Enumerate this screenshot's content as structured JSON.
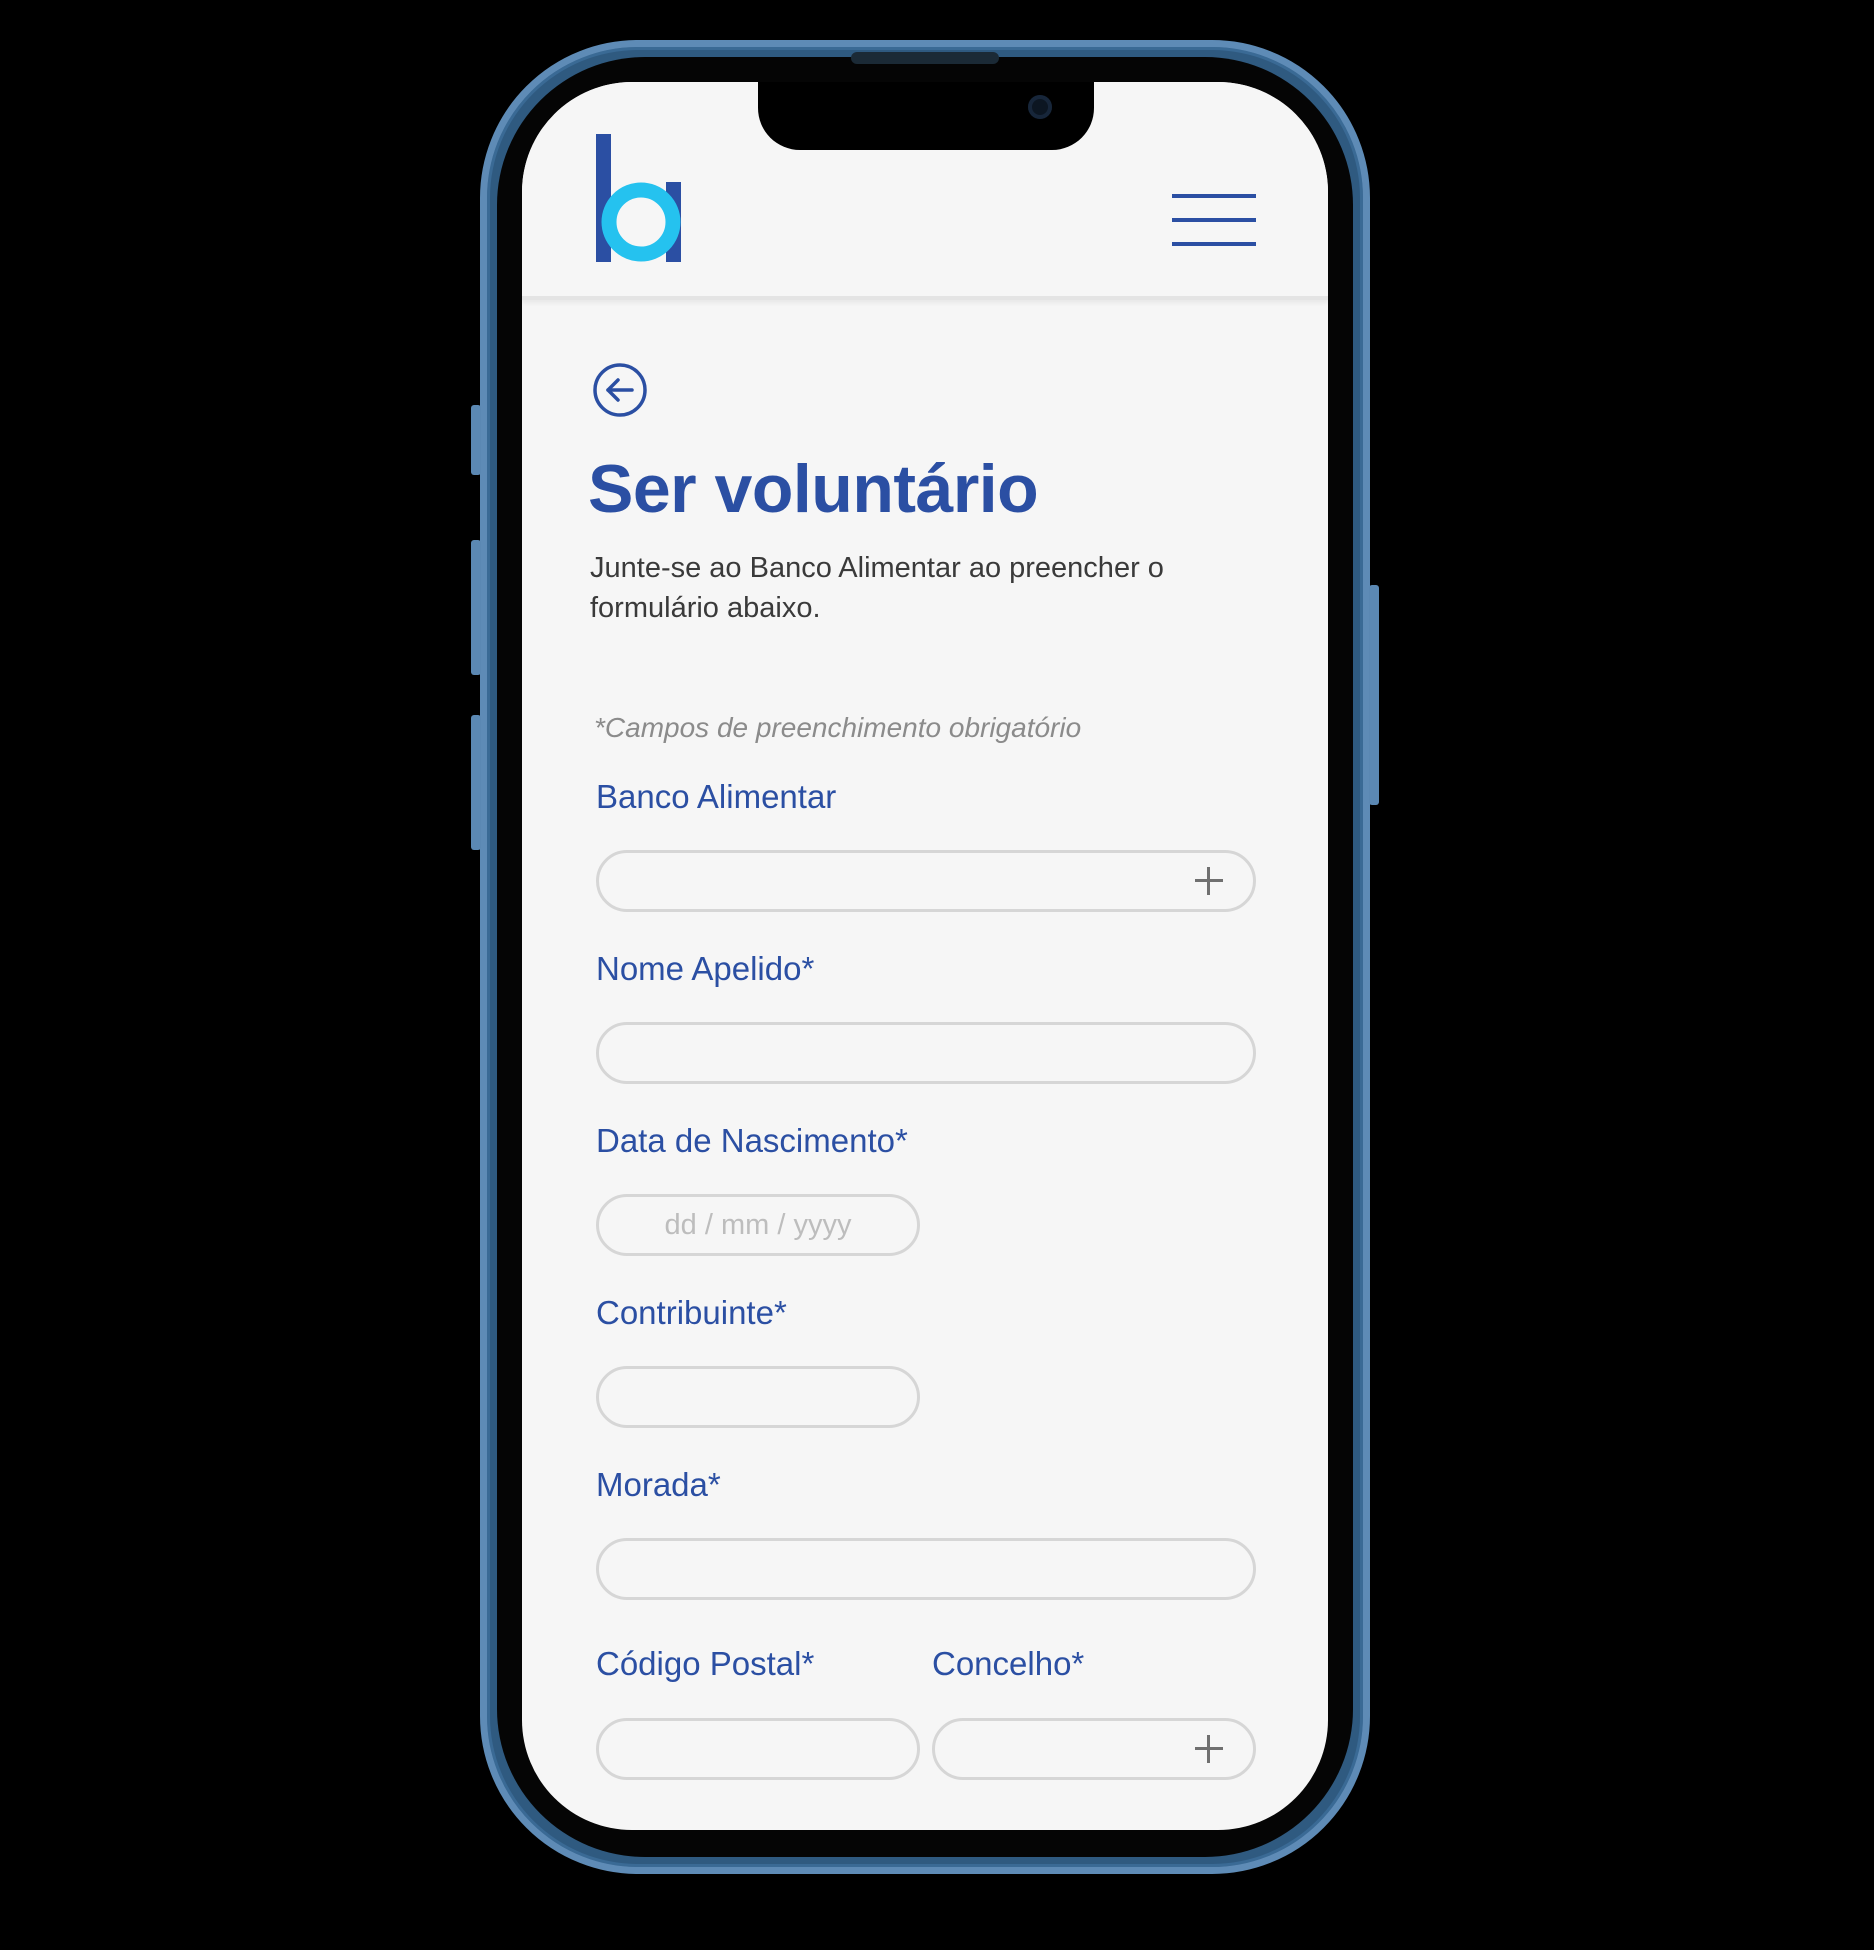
{
  "header": {
    "logo_name": "banco-alimentar-logo",
    "menu_icon": "hamburger-menu-icon"
  },
  "page": {
    "back_icon": "arrow-left-circle-icon",
    "title": "Ser voluntário",
    "subtitle": "Junte-se ao Banco Alimentar ao preencher o formulário abaixo.",
    "required_note": "*Campos de preenchimento obrigatório"
  },
  "form": {
    "banco_alimentar": {
      "label": "Banco Alimentar",
      "value": "",
      "icon": "plus-icon"
    },
    "nome_apelido": {
      "label": "Nome Apelido*",
      "value": ""
    },
    "data_nascimento": {
      "label": "Data de Nascimento*",
      "value": "",
      "placeholder": "dd / mm / yyyy"
    },
    "contribuinte": {
      "label": "Contribuinte*",
      "value": ""
    },
    "morada": {
      "label": "Morada*",
      "value": ""
    },
    "codigo_postal": {
      "label": "Código Postal*",
      "value": ""
    },
    "concelho": {
      "label": "Concelho*",
      "value": "",
      "icon": "plus-icon"
    }
  },
  "colors": {
    "primary": "#2b4fa3",
    "logo_accent": "#25c2ef",
    "background": "#f6f6f6",
    "phone_frame": "#5e8bb6"
  }
}
